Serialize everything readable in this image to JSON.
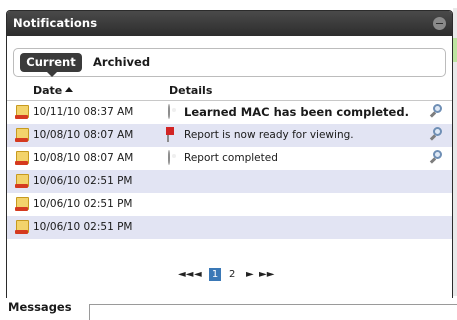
{
  "panel": {
    "title": "Notifications"
  },
  "tabs": [
    {
      "label": "Current",
      "active": true
    },
    {
      "label": "Archived",
      "active": false
    }
  ],
  "columns": {
    "date": "Date",
    "details": "Details"
  },
  "rows": [
    {
      "date": "10/11/10 08:37 AM",
      "detail_icon": "gear-icon",
      "detail": "Learned MAC has been completed.",
      "bold": true
    },
    {
      "date": "10/08/10 08:07 AM",
      "detail_icon": "pdf-icon",
      "detail": "Report is now ready for viewing.",
      "bold": false
    },
    {
      "date": "10/08/10 08:07 AM",
      "detail_icon": "gear-icon",
      "detail": "Report completed",
      "bold": false
    },
    {
      "date": "10/06/10 02:51 PM",
      "detail_icon": "",
      "detail": "",
      "bold": false
    },
    {
      "date": "10/06/10 02:51 PM",
      "detail_icon": "",
      "detail": "",
      "bold": false
    },
    {
      "date": "10/06/10 02:51 PM",
      "detail_icon": "",
      "detail": "",
      "bold": false
    }
  ],
  "pager": {
    "first": "◄◄",
    "prev": "◄",
    "pages": [
      "1",
      "2"
    ],
    "current_page": "1",
    "next": "►",
    "last": "►►"
  },
  "bottom": {
    "messages_tab": "Messages"
  },
  "colors": {
    "header": "#333333",
    "row_alt": "#e2e4f3",
    "pager_active": "#3a78b6"
  }
}
